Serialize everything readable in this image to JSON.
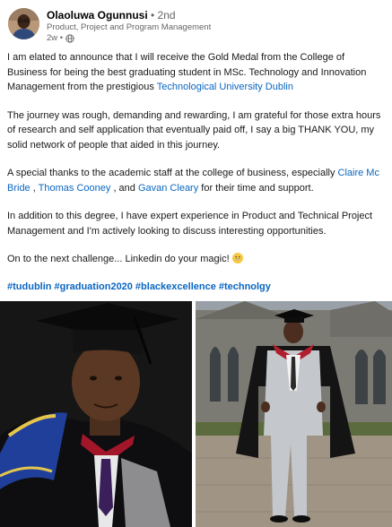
{
  "post": {
    "author": {
      "name": "Olaoluwa Ogunnusi",
      "degree": "• 2nd",
      "headline": "Product, Project and Program Management",
      "timestamp": "2w •",
      "visibility_icon": "globe-icon"
    },
    "paragraphs": {
      "p1_text": "I am elated to announce that I will receive the Gold Medal from the College of Business for being the best graduating student in MSc. Technology and Innovation Management from the prestigious ",
      "p1_link": "Technological University Dublin",
      "p2": "The journey was rough, demanding and rewarding, I am grateful for those extra hours of research and self application that eventually paid off, I say a big THANK YOU, my solid network of people that aided in this journey.",
      "p3_text": "A special thanks to the academic staff at the college of business, especially ",
      "p3_mention1": "Claire Mc Bride",
      "p3_sep1": " , ",
      "p3_mention2": "Thomas Cooney",
      "p3_sep2": " , and ",
      "p3_mention3": "Gavan Cleary",
      "p3_end": " for their time and support.",
      "p4": "In addition to this degree, I have expert experience in Product and Technical Project Management and I'm actively looking to discuss interesting opportunities.",
      "p5_text": "On to the next challenge... Linkedin do your magic! ",
      "p5_emoji": "grinning-face-emoji"
    },
    "hashtags": [
      "#tudublin",
      "#graduation2020",
      "#blackexcellence",
      "#technolgy"
    ],
    "images": [
      "graduate-portrait-photo",
      "graduate-full-length-photo"
    ]
  },
  "colors": {
    "link": "#0a66c2",
    "text": "#191919",
    "muted": "#666666"
  }
}
